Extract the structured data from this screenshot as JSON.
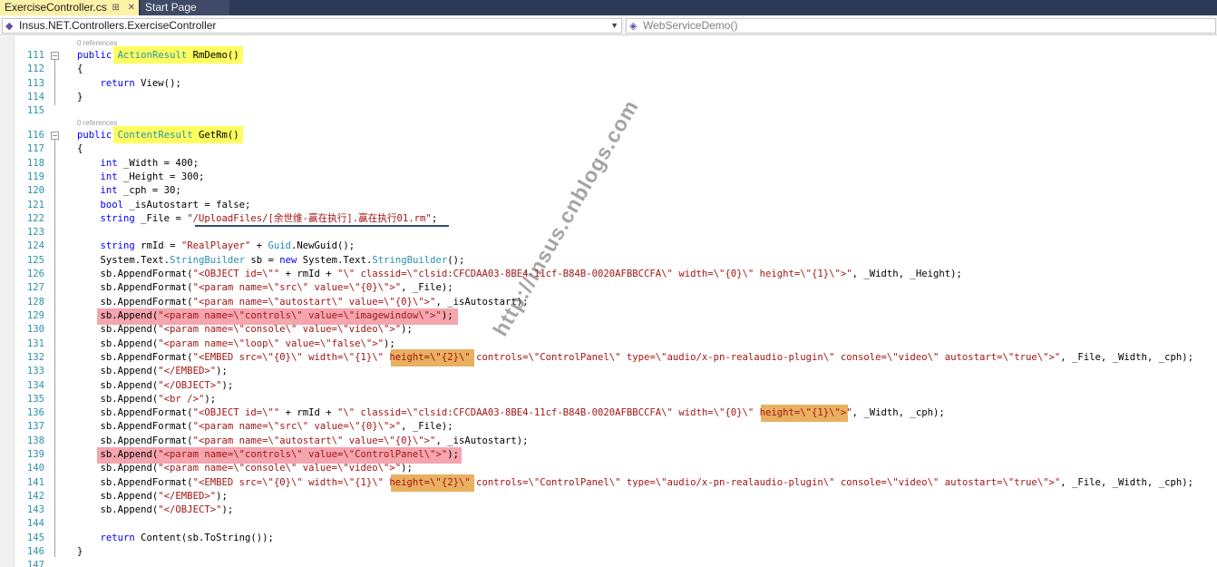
{
  "tabs": {
    "active": "ExerciseController.cs",
    "inactive": "Start Page",
    "icons": [
      "pin-icon",
      "close-icon"
    ]
  },
  "nav": {
    "type_combo": "Insus.NET.Controllers.ExerciseController",
    "member_combo": "WebServiceDemo()"
  },
  "refs": {
    "a": "0 references",
    "b": "0 references"
  },
  "lines": [
    {
      "n": "111",
      "t": "public ActionResult RmDemo()"
    },
    {
      "n": "112",
      "t": "{"
    },
    {
      "n": "113",
      "t": "    return View();"
    },
    {
      "n": "114",
      "t": "}"
    },
    {
      "n": "115",
      "t": ""
    },
    {
      "n": "116",
      "t": "public ContentResult GetRm()"
    },
    {
      "n": "117",
      "t": "{"
    },
    {
      "n": "118",
      "t": "    int _Width = 400;"
    },
    {
      "n": "119",
      "t": "    int _Height = 300;"
    },
    {
      "n": "120",
      "t": "    int _cph = 30;"
    },
    {
      "n": "121",
      "t": "    bool _isAutostart = false;"
    },
    {
      "n": "122",
      "t": "    string _File = \"/UploadFiles/[余世维-赢在执行].赢在执行01.rm\";"
    },
    {
      "n": "123",
      "t": ""
    },
    {
      "n": "124",
      "t": "    string rmId = \"RealPlayer\" + Guid.NewGuid();"
    },
    {
      "n": "125",
      "t": "    System.Text.StringBuilder sb = new System.Text.StringBuilder();"
    },
    {
      "n": "126",
      "t": "    sb.AppendFormat(\"<OBJECT id=\\\"\" + rmId + \"\\\" classid=\\\"clsid:CFCDAA03-8BE4-11cf-B84B-0020AFBBCCFA\\\" width=\\\"{0}\\\" height=\\\"{1}\\\">\", _Width, _Height);"
    },
    {
      "n": "127",
      "t": "    sb.AppendFormat(\"<param name=\\\"src\\\" value=\\\"{0}\\\">\", _File);"
    },
    {
      "n": "128",
      "t": "    sb.AppendFormat(\"<param name=\\\"autostart\\\" value=\\\"{0}\\\">\", _isAutostart);"
    },
    {
      "n": "129",
      "t": "    sb.Append(\"<param name=\\\"controls\\\" value=\\\"imagewindow\\\">\");"
    },
    {
      "n": "130",
      "t": "    sb.Append(\"<param name=\\\"console\\\" value=\\\"video\\\">\");"
    },
    {
      "n": "131",
      "t": "    sb.Append(\"<param name=\\\"loop\\\" value=\\\"false\\\">\");"
    },
    {
      "n": "132",
      "t": "    sb.AppendFormat(\"<EMBED src=\\\"{0}\\\" width=\\\"{1}\\\" height=\\\"{2}\\\" controls=\\\"ControlPanel\\\" type=\\\"audio/x-pn-realaudio-plugin\\\" console=\\\"video\\\" autostart=\\\"true\\\">\", _File, _Width, _cph);"
    },
    {
      "n": "133",
      "t": "    sb.Append(\"</EMBED>\");"
    },
    {
      "n": "134",
      "t": "    sb.Append(\"</OBJECT>\");"
    },
    {
      "n": "135",
      "t": "    sb.Append(\"<br />\");"
    },
    {
      "n": "136",
      "t": "    sb.AppendFormat(\"<OBJECT id=\\\"\" + rmId + \"\\\" classid=\\\"clsid:CFCDAA03-8BE4-11cf-B84B-0020AFBBCCFA\\\" width=\\\"{0}\\\" height=\\\"{1}\\\">\", _Width, _cph);"
    },
    {
      "n": "137",
      "t": "    sb.AppendFormat(\"<param name=\\\"src\\\" value=\\\"{0}\\\">\", _File);"
    },
    {
      "n": "138",
      "t": "    sb.AppendFormat(\"<param name=\\\"autostart\\\" value=\\\"{0}\\\">\", _isAutostart);"
    },
    {
      "n": "139",
      "t": "    sb.Append(\"<param name=\\\"controls\\\" value=\\\"ControlPanel\\\">\");"
    },
    {
      "n": "140",
      "t": "    sb.Append(\"<param name=\\\"console\\\" value=\\\"video\\\">\");"
    },
    {
      "n": "141",
      "t": "    sb.AppendFormat(\"<EMBED src=\\\"{0}\\\" width=\\\"{1}\\\" height=\\\"{2}\\\" controls=\\\"ControlPanel\\\" type=\\\"audio/x-pn-realaudio-plugin\\\" console=\\\"video\\\" autostart=\\\"true\\\">\", _File, _Width, _cph);"
    },
    {
      "n": "142",
      "t": "    sb.Append(\"</EMBED>\");"
    },
    {
      "n": "143",
      "t": "    sb.Append(\"</OBJECT>\");"
    },
    {
      "n": "144",
      "t": ""
    },
    {
      "n": "145",
      "t": "    return Content(sb.ToString());"
    },
    {
      "n": "146",
      "t": "}"
    },
    {
      "n": "147",
      "t": ""
    }
  ],
  "watermark": "http://insus.cnblogs.com",
  "colors": {
    "keyword": "#0000ff",
    "type": "#2b91af",
    "string": "#a31515",
    "highlight_yellow": "#fefe5f",
    "highlight_orange": "#e8b060",
    "highlight_red": "#f4a5ae"
  }
}
